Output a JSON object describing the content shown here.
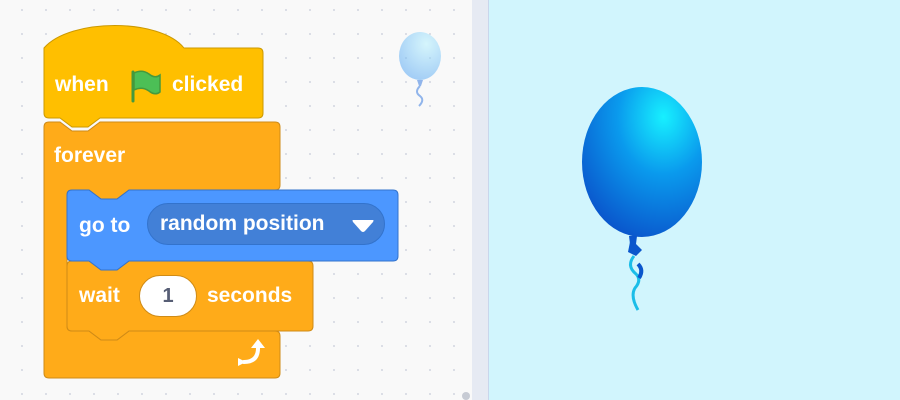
{
  "code_area": {
    "blocks": {
      "hat": {
        "text_before": "when",
        "text_after": "clicked",
        "icon": "green-flag-icon"
      },
      "forever": {
        "label": "forever",
        "loop_icon": "loop-arrow-icon"
      },
      "goto": {
        "label": "go to",
        "dropdown_value": "random position",
        "dropdown_icon": "triangle-down-icon"
      },
      "wait": {
        "label": "wait",
        "input_value": "1",
        "unit": "seconds"
      }
    },
    "sprite_icon": "balloon-icon"
  },
  "stage": {
    "sprite": "balloon-icon"
  },
  "colors": {
    "events": "#ffbf00",
    "control": "#ffab19",
    "motion": "#4c97ff",
    "stage_bg": "#d1f5fd",
    "flag": "#4cbf56"
  }
}
